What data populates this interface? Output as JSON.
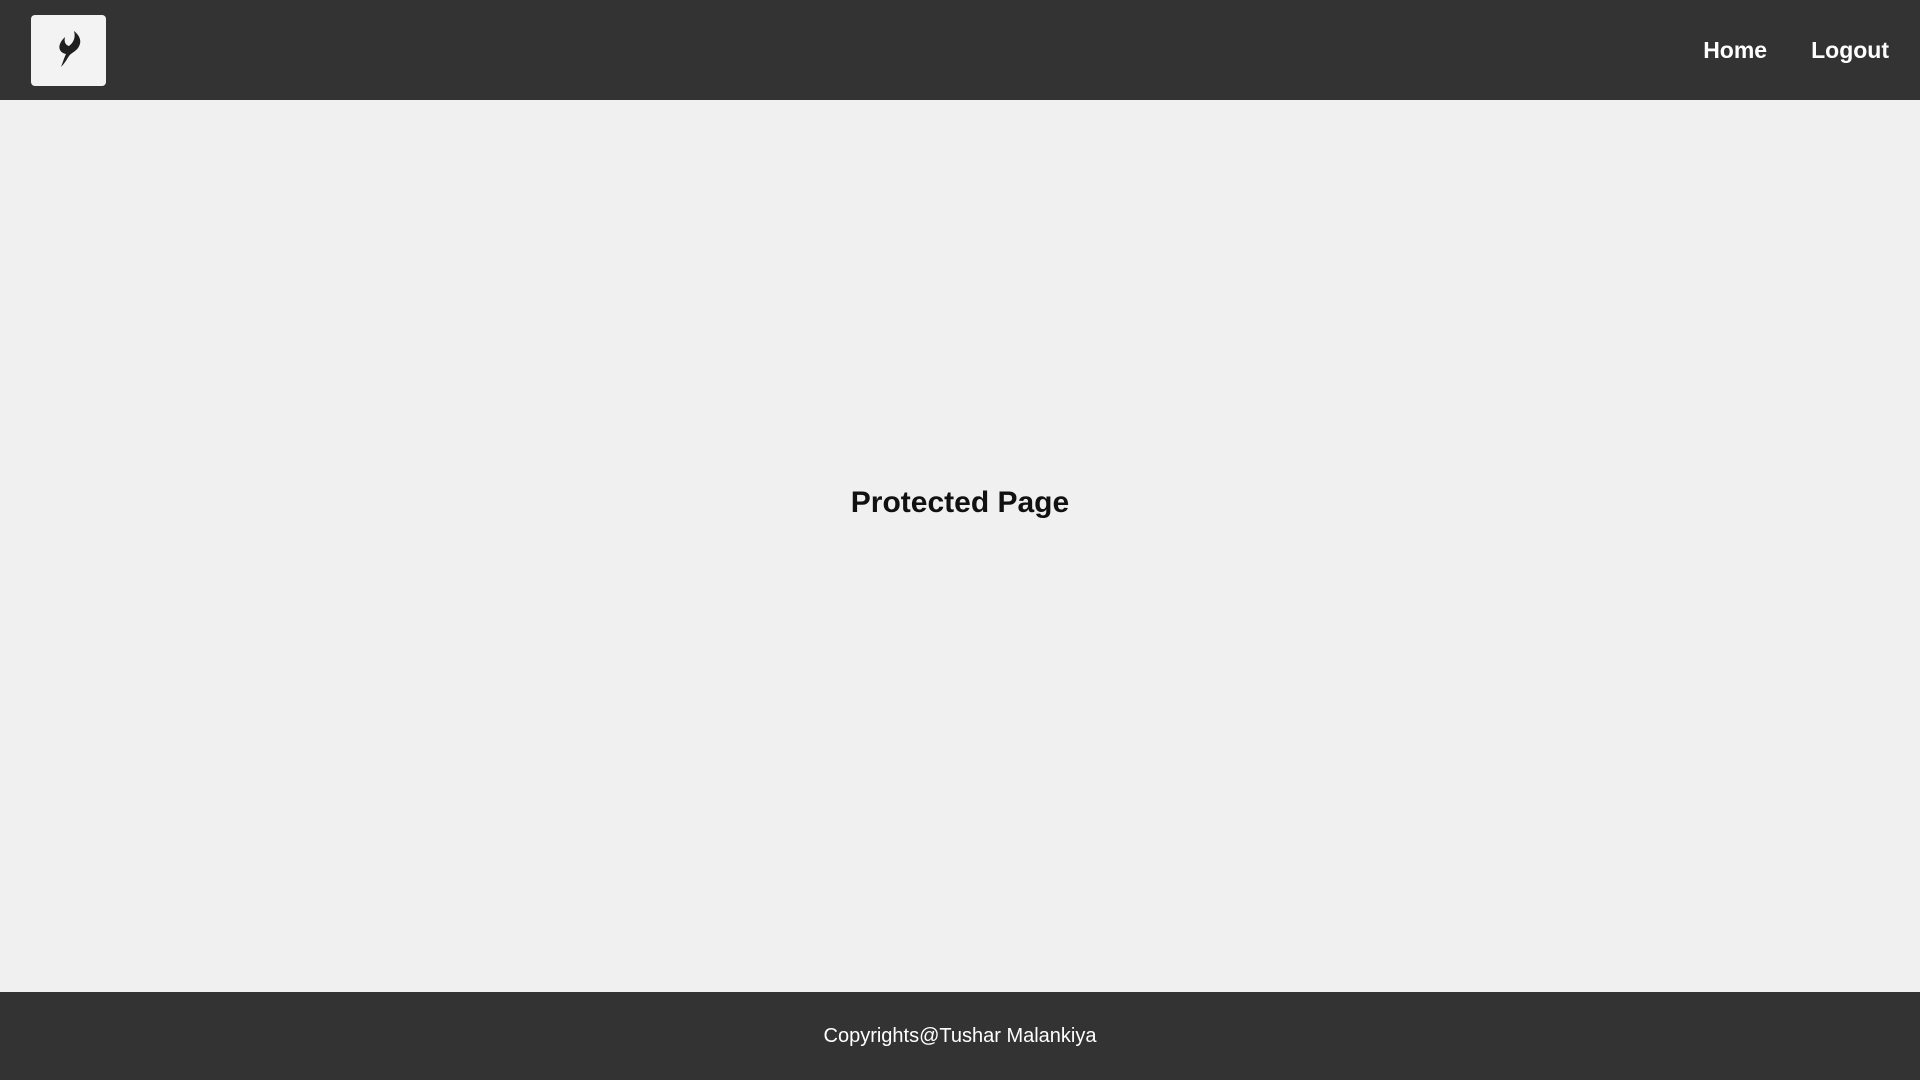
{
  "header": {
    "logo_icon": "flame-logo-icon",
    "nav": {
      "home_label": "Home",
      "logout_label": "Logout"
    }
  },
  "main": {
    "title": "Protected Page"
  },
  "footer": {
    "copyright": "Copyrights@Tushar Malankiya"
  },
  "colors": {
    "header_bg": "#333333",
    "footer_bg": "#333333",
    "page_bg": "#f0f0f0",
    "logo_bg": "#f3f3f3",
    "nav_text": "#ffffff"
  }
}
